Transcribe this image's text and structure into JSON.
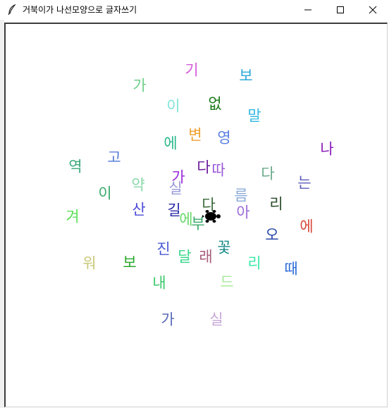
{
  "window": {
    "title": "거북이가 나선모양으로 글자쓰기",
    "controls": {
      "minimize": "minimize-icon",
      "maximize": "maximize-icon",
      "close": "close-icon"
    }
  },
  "canvas": {
    "background": "#ffffff",
    "cursor_icon": "turtle-icon",
    "characters": [
      {
        "text": "기",
        "color": "#d35ad8"
      },
      {
        "text": "보",
        "color": "#2aa9d9"
      },
      {
        "text": "가",
        "color": "#6fcf8a"
      },
      {
        "text": "없",
        "color": "#1a7a1a"
      },
      {
        "text": "이",
        "color": "#7fe3d8"
      },
      {
        "text": "말",
        "color": "#35b8e0"
      },
      {
        "text": "변",
        "color": "#f0a030"
      },
      {
        "text": "영",
        "color": "#5a7fe0"
      },
      {
        "text": "에",
        "color": "#2ab88a"
      },
      {
        "text": "나",
        "color": "#8a1ab8"
      },
      {
        "text": "고",
        "color": "#5a7fd8"
      },
      {
        "text": "역",
        "color": "#3aa97a"
      },
      {
        "text": "다",
        "color": "#6a1a9a"
      },
      {
        "text": "따",
        "color": "#9a5ad8"
      },
      {
        "text": "가",
        "color": "#9a2ad8"
      },
      {
        "text": "다",
        "color": "#6aa98a"
      },
      {
        "text": "는",
        "color": "#5a5ab8"
      },
      {
        "text": "이",
        "color": "#3aa96a"
      },
      {
        "text": "약",
        "color": "#8ad8a8"
      },
      {
        "text": "실",
        "color": "#9a9ad8"
      },
      {
        "text": "름",
        "color": "#8aaad8"
      },
      {
        "text": "리",
        "color": "#2a4a2a"
      },
      {
        "text": "겨",
        "color": "#5ae05a"
      },
      {
        "text": "산",
        "color": "#4a4ad8"
      },
      {
        "text": "길",
        "color": "#2a2aa8"
      },
      {
        "text": "다",
        "color": "#3a6a3a"
      },
      {
        "text": "아",
        "color": "#9a6ad8"
      },
      {
        "text": "에",
        "color": "#d84a3a"
      },
      {
        "text": "에",
        "color": "#6ad86a"
      },
      {
        "text": "부",
        "color": "#3aa96a"
      },
      {
        "text": "오",
        "color": "#2a4aa8"
      },
      {
        "text": "진",
        "color": "#4a5ad8"
      },
      {
        "text": "꽃",
        "color": "#1a8a8a"
      },
      {
        "text": "달",
        "color": "#3ad88a"
      },
      {
        "text": "래",
        "color": "#a85a7a"
      },
      {
        "text": "워",
        "color": "#c8c87a"
      },
      {
        "text": "보",
        "color": "#2aa82a"
      },
      {
        "text": "리",
        "color": "#3ae8a8"
      },
      {
        "text": "때",
        "color": "#2a6ad8"
      },
      {
        "text": "내",
        "color": "#3ac86a"
      },
      {
        "text": "드",
        "color": "#a8e89a"
      },
      {
        "text": "가",
        "color": "#5a6ab8"
      },
      {
        "text": "실",
        "color": "#c8a8d8"
      }
    ]
  }
}
